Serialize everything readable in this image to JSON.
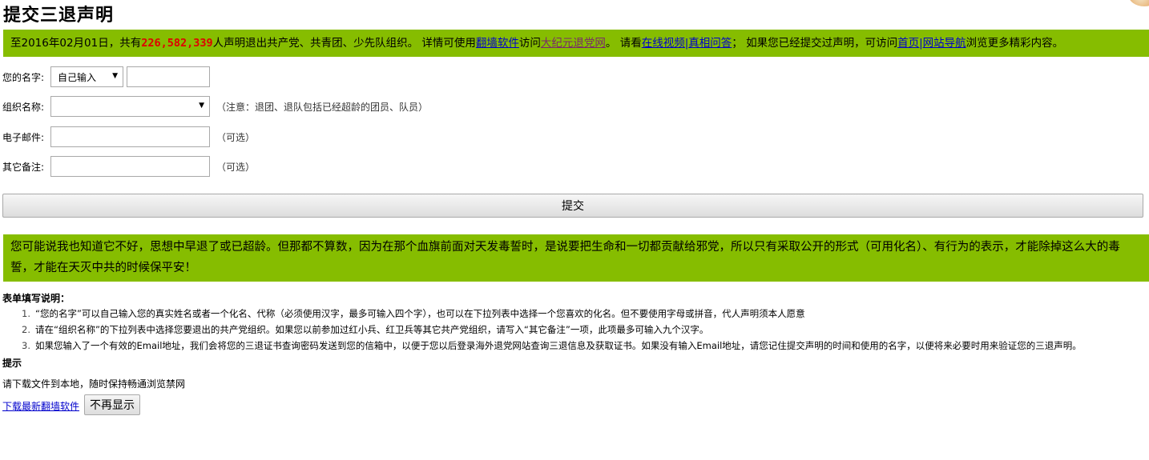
{
  "page_title": "提交三退声明",
  "top_banner": {
    "prefix": "至2016年02月01日，共有",
    "count": "226,582,339",
    "after_count": "人声明退出共产党、共青团、少先队组织。 详情可使用",
    "link_software": "翻墙软件",
    "text_visit": "访问",
    "link_dajiyuan": "大纪元退党网",
    "text_watch": "。 请看",
    "link_video": "在线视频",
    "sep1": "|",
    "link_qa": "真相问答",
    "text_if": "； 如果您已经提交过声明，可访问",
    "link_home": "首页",
    "sep2": "|",
    "link_nav": "网站导航",
    "text_end": "浏览更多精彩内容。"
  },
  "form": {
    "name_label": "您的名字:",
    "name_select_value": "自己输入",
    "name_input_value": "",
    "org_label": "组织名称:",
    "org_select_value": "",
    "org_note": "（注意：退团、退队包括已经超龄的团员、队员）",
    "email_label": "电子邮件:",
    "email_value": "",
    "email_note": "（可选）",
    "remark_label": "其它备注:",
    "remark_value": "",
    "remark_note": "（可选）",
    "submit_label": "提交"
  },
  "mid_banner": {
    "text": "您可能说我也知道它不好，思想中早退了或已超龄。但那都不算数，因为在那个血旗前面对天发毒誓时，是说要把生命和一切都贡献给邪党，所以只有采取公开的形式（可用化名）、有行为的表示，才能除掉这么大的毒誓，才能在天灭中共的时候保平安！"
  },
  "instructions": {
    "title": "表单填写说明：",
    "items": [
      {
        "num": "1.",
        "text": "“您的名字”可以自己输入您的真实姓名或者一个化名、代称（必须使用汉字，最多可输入四个字），也可以在下拉列表中选择一个您喜欢的化名。但不要使用字母或拼音，代人声明须本人愿意"
      },
      {
        "num": "2.",
        "text": "请在“组织名称”的下拉列表中选择您要退出的共产党组织。如果您以前参加过红小兵、红卫兵等其它共产党组织，请写入“其它备注”一项，此项最多可输入九个汉字。"
      },
      {
        "num": "3.",
        "text": "如果您输入了一个有效的Email地址，我们会将您的三退证书查询密码发送到您的信箱中，以便于您以后登录海外退党网站查询三退信息及获取证书。如果没有输入Email地址，请您记住提交声明的时间和使用的名字，以便将来必要时用来验证您的三退声明。"
      }
    ]
  },
  "tip": {
    "title": "提示",
    "text": "请下载文件到本地，随时保持畅通浏览禁网",
    "download_link": "下载最新翻墙软件",
    "hide_button": "不再显示"
  },
  "colors": {
    "banner_bg": "#86bd00",
    "count_color": "#e00000",
    "link_color": "#0000cc"
  }
}
